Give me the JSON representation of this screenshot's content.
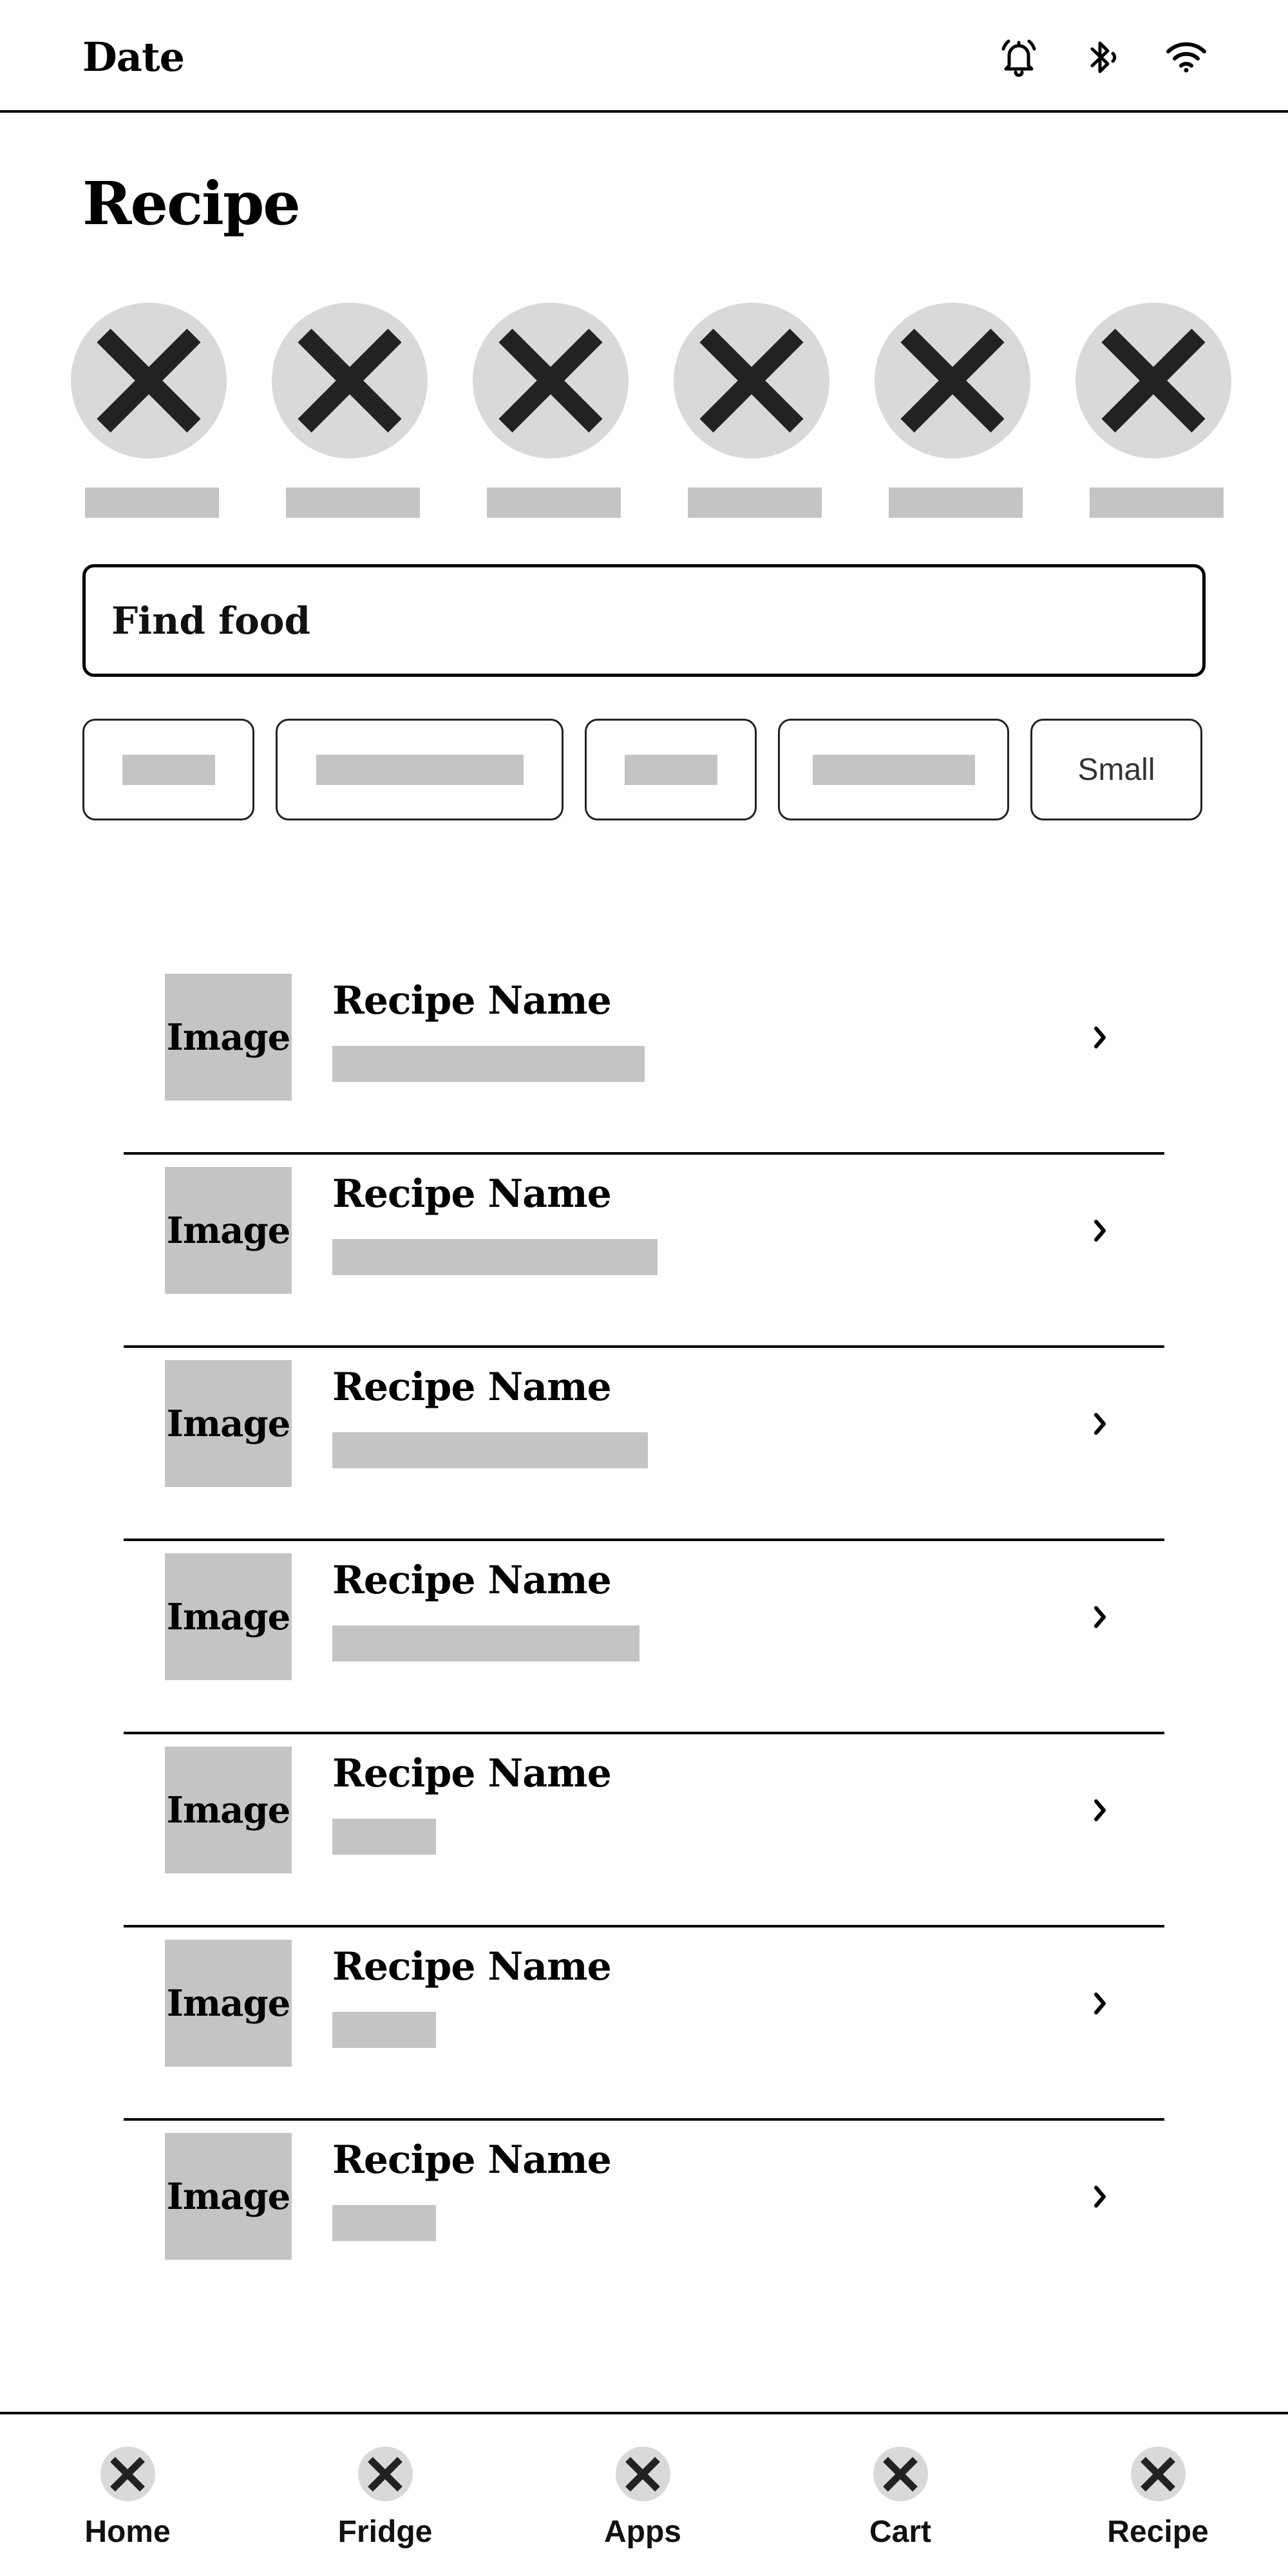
{
  "status_bar": {
    "date": "Date",
    "icons": [
      "alarm-icon",
      "bluetooth-icon",
      "wifi-icon"
    ]
  },
  "page_title": "Recipe",
  "categories": {
    "count": 6,
    "icon": "placeholder-x-icon"
  },
  "search": {
    "placeholder": "Find food"
  },
  "filters": [
    {
      "label": ""
    },
    {
      "label": ""
    },
    {
      "label": ""
    },
    {
      "label": ""
    },
    {
      "label": "Small"
    }
  ],
  "recipes": [
    {
      "image_label": "Image",
      "name": "Recipe Name"
    },
    {
      "image_label": "Image",
      "name": "Recipe Name"
    },
    {
      "image_label": "Image",
      "name": "Recipe Name"
    },
    {
      "image_label": "Image",
      "name": "Recipe Name"
    },
    {
      "image_label": "Image",
      "name": "Recipe Name"
    },
    {
      "image_label": "Image",
      "name": "Recipe Name"
    },
    {
      "image_label": "Image",
      "name": "Recipe Name"
    }
  ],
  "bottom_nav": [
    {
      "label": "Home",
      "icon": "placeholder-x-icon"
    },
    {
      "label": "Fridge",
      "icon": "placeholder-x-icon"
    },
    {
      "label": "Apps",
      "icon": "placeholder-x-icon"
    },
    {
      "label": "Cart",
      "icon": "placeholder-x-icon"
    },
    {
      "label": "Recipe",
      "icon": "placeholder-x-icon"
    }
  ],
  "colors": {
    "placeholder_fill": "#c4c4c4",
    "circle_fill": "#d9d9d9",
    "icon_stroke": "#222222",
    "border": "#000000"
  }
}
